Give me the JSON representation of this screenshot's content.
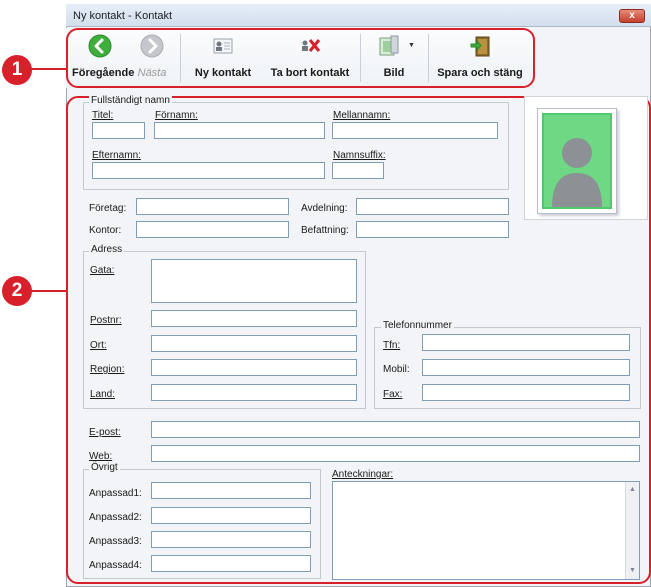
{
  "window": {
    "title": "Ny kontakt - Kontakt",
    "close_glyph": "x"
  },
  "toolbar": {
    "prev_label": "Föregående",
    "next_label": "Nästa",
    "new_label": "Ny kontakt",
    "delete_label": "Ta bort kontakt",
    "image_label": "Bild",
    "save_label": "Spara och stäng",
    "dropdown_glyph": "▼",
    "icons": [
      "arrow-left-icon",
      "arrow-right-icon",
      "new-contact-icon",
      "delete-contact-icon",
      "image-icon",
      "save-close-icon"
    ]
  },
  "callouts": [
    "1",
    "2"
  ],
  "name_group": {
    "title": "Fullständigt namn",
    "title_label": "Titel:",
    "first_label": "Förnamn:",
    "middle_label": "Mellannamn:",
    "last_label": "Efternamn:",
    "suffix_label": "Namnsuffix:"
  },
  "company": {
    "company_label": "Företag:",
    "department_label": "Avdelning:",
    "office_label": "Kontor:",
    "position_label": "Befattning:"
  },
  "address": {
    "title": "Adress",
    "street_label": "Gata:",
    "postal_label": "Postnr:",
    "city_label": "Ort:",
    "region_label": "Region:",
    "country_label": "Land:"
  },
  "phone": {
    "title": "Telefonnummer",
    "phone_label": "Tfn:",
    "mobile_label": "Mobil:",
    "fax_label": "Fax:"
  },
  "email_label": "E-post:",
  "web_label": "Web:",
  "other": {
    "title": "Övrigt",
    "custom1_label": "Anpassad1:",
    "custom2_label": "Anpassad2:",
    "custom3_label": "Anpassad3:",
    "custom4_label": "Anpassad4:"
  },
  "notes_label": "Anteckningar:",
  "colors": {
    "callout": "#d8202a",
    "accent_green": "#3fae3c",
    "field_border": "#7f9db9"
  }
}
